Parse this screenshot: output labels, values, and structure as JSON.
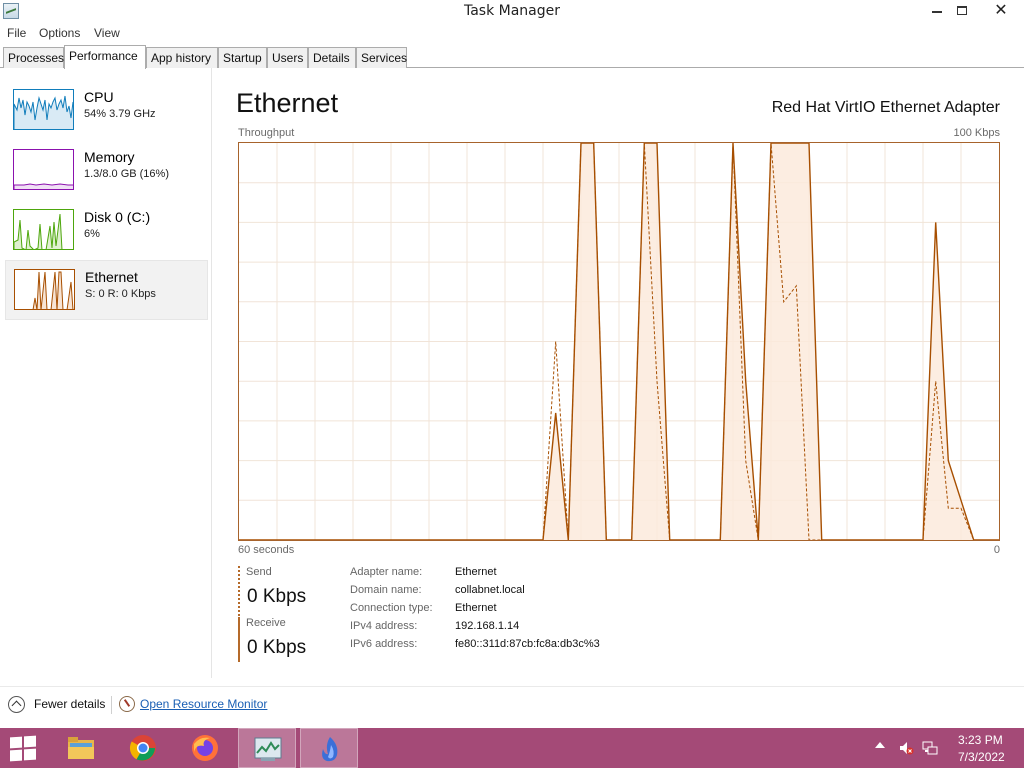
{
  "window": {
    "title": "Task Manager"
  },
  "menu": [
    "File",
    "Options",
    "View"
  ],
  "tabs": [
    "Processes",
    "Performance",
    "App history",
    "Startup",
    "Users",
    "Details",
    "Services"
  ],
  "sidebar": {
    "items": [
      {
        "name": "CPU",
        "value": "54% 3.79 GHz",
        "color": "#117dbb"
      },
      {
        "name": "Memory",
        "value": "1.3/8.0 GB (16%)",
        "color": "#8b12ae"
      },
      {
        "name": "Disk 0 (C:)",
        "value": "6%",
        "color": "#4da60c"
      },
      {
        "name": "Ethernet",
        "value": "S: 0 R: 0 Kbps",
        "color": "#a74f01"
      }
    ]
  },
  "main": {
    "title": "Ethernet",
    "adapter": "Red Hat VirtIO Ethernet Adapter",
    "graph_label": "Throughput",
    "graph_max": "100 Kbps",
    "x_left": "60 seconds",
    "x_right": "0"
  },
  "stats": {
    "send_label": "Send",
    "send_value": "0 Kbps",
    "recv_label": "Receive",
    "recv_value": "0 Kbps"
  },
  "properties": [
    {
      "key": "Adapter name:",
      "value": "Ethernet"
    },
    {
      "key": "Domain name:",
      "value": "collabnet.local"
    },
    {
      "key": "Connection type:",
      "value": "Ethernet"
    },
    {
      "key": "IPv4 address:",
      "value": "192.168.1.14"
    },
    {
      "key": "IPv6 address:",
      "value": "fe80::311d:87cb:fc8a:db3c%3"
    }
  ],
  "footer": {
    "fewer_details": "Fewer details",
    "resource_monitor": "Open Resource Monitor"
  },
  "taskbar": {
    "time": "3:23 PM",
    "date": "7/3/2022"
  },
  "chart_data": {
    "type": "area",
    "x": [
      60,
      59,
      58,
      57,
      56,
      55,
      54,
      53,
      52,
      51,
      50,
      49,
      48,
      47,
      46,
      45,
      44,
      43,
      42,
      41,
      40,
      39,
      38,
      37,
      36,
      35,
      34,
      33,
      32,
      31,
      30,
      29,
      28,
      27,
      26,
      25,
      24,
      23,
      22,
      21,
      20,
      19,
      18,
      17,
      16,
      15,
      14,
      13,
      12,
      11,
      10,
      9,
      8,
      7,
      6,
      5,
      4,
      3,
      2,
      1,
      0
    ],
    "series": [
      {
        "name": "Receive",
        "values": [
          0,
          0,
          0,
          0,
          0,
          0,
          0,
          0,
          0,
          0,
          0,
          0,
          0,
          0,
          0,
          0,
          0,
          0,
          0,
          0,
          0,
          0,
          0,
          0,
          0,
          32,
          0,
          100,
          100,
          0,
          0,
          0,
          100,
          100,
          0,
          0,
          0,
          0,
          0,
          100,
          40,
          0,
          100,
          100,
          100,
          100,
          0,
          0,
          0,
          0,
          0,
          0,
          0,
          0,
          0,
          80,
          20,
          10,
          0,
          0,
          0
        ]
      },
      {
        "name": "Send",
        "values": [
          0,
          0,
          0,
          0,
          0,
          0,
          0,
          0,
          0,
          0,
          0,
          0,
          0,
          0,
          0,
          0,
          0,
          0,
          0,
          0,
          0,
          0,
          0,
          0,
          0,
          50,
          0,
          100,
          100,
          0,
          0,
          0,
          100,
          40,
          0,
          0,
          0,
          0,
          0,
          100,
          20,
          0,
          100,
          60,
          64,
          0,
          0,
          0,
          0,
          0,
          0,
          0,
          0,
          0,
          0,
          40,
          8,
          8,
          0,
          0,
          0
        ]
      }
    ],
    "xlabel": "",
    "ylabel": "",
    "ylim": [
      0,
      100
    ],
    "grid": true
  }
}
